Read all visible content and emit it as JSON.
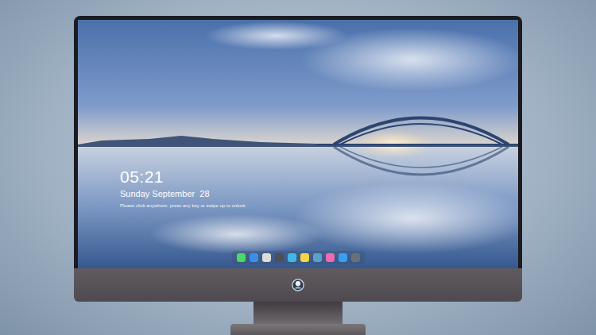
{
  "lock_screen": {
    "time": "05:21",
    "date": "Sunday September  28",
    "hint": "Please click anywhere, press any key or swipe up to unlock"
  },
  "dock": {
    "apps": [
      {
        "color": "#4cd964"
      },
      {
        "color": "#3a8ee6"
      },
      {
        "color": "#dcdcdc"
      },
      {
        "color": "#4a4f58"
      },
      {
        "color": "#43b7e6"
      },
      {
        "color": "#f5d547"
      },
      {
        "color": "#5aa0c8"
      },
      {
        "color": "#f06ab0"
      },
      {
        "color": "#3b9cf0"
      },
      {
        "color": "#6b6f78"
      }
    ]
  }
}
